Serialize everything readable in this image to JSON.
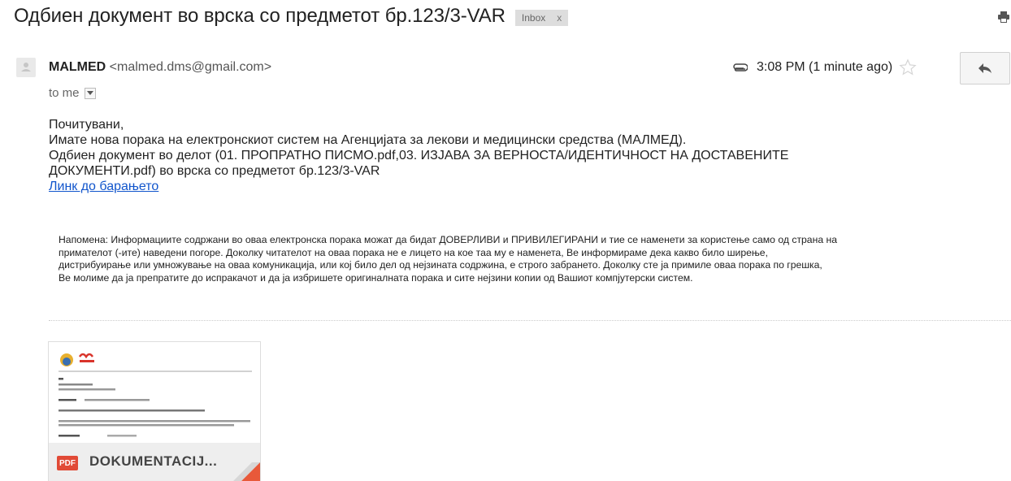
{
  "email": {
    "subject": "Одбиен документ во врска со предметот бр.123/3-VAR",
    "label": {
      "text": "Inbox",
      "remove": "x"
    },
    "sender": {
      "name": "MALMED",
      "email": "<malmed.dms@gmail.com>"
    },
    "to": "to me",
    "time": "3:08 PM (1 minute ago)",
    "body": {
      "greeting": "Почитувани,",
      "line1": "Имате нова порака на електронскиот систем на Агенцијата за лекови и медицински средства (МАЛМЕД).",
      "line2": "Одбиен документ во делот (01. ПРОПРАТНО ПИСМО.pdf,03. ИЗЈАВА ЗА ВЕРНОСТА/ИДЕНТИЧНОСТ НА ДОСТАВЕНИТЕ",
      "line3": "ДОКУМЕНТИ.pdf) во врска со предметот бр.123/3-VAR",
      "link": "Линк до барањето"
    },
    "disclaimer": [
      "Напомена: Информациите содржани во оваа електронска порака можат да бидат ДОВЕРЛИВИ и ПРИВИЛЕГИРАНИ и тие се наменети за користење само од страна на",
      "примателот (-ите) наведени погоре. Доколку читателот на оваа порака не е лицето на кое таа му е наменета, Ве информираме дека какво било ширење,",
      "дистрибуирање или умножување на оваа комуникација, или кој било дел од нејзината содржина, е строго забрането. Доколку сте ја примиле оваа порака по грешка,",
      "Ве молиме да ја препратите до испракачот и да ја избришете оригиналната порака и сите нејзини копии од Вашиот компјутерски систем."
    ],
    "attachment": {
      "type": "PDF",
      "name": "DOKUMENTACIJ..."
    }
  },
  "colors": {
    "link": "#1155cc",
    "pdf_badge": "#e14a36",
    "label_bg": "#dddddd"
  },
  "icons": [
    "print-icon",
    "avatar-icon",
    "attachment-icon",
    "star-icon",
    "reply-icon",
    "chevron-down-icon"
  ]
}
